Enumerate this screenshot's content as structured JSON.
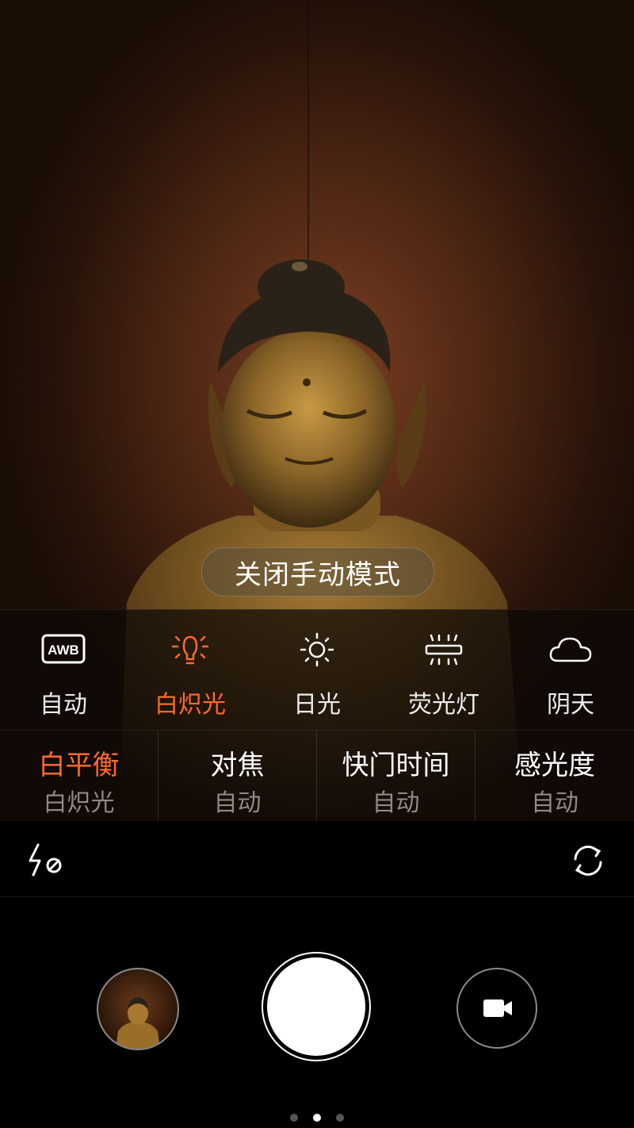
{
  "manual_mode": {
    "close_label": "关闭手动模式"
  },
  "white_balance": {
    "options": [
      {
        "label": "自动",
        "icon": "awb-icon"
      },
      {
        "label": "白炽光",
        "icon": "bulb-icon",
        "selected": true
      },
      {
        "label": "日光",
        "icon": "sun-icon"
      },
      {
        "label": "荧光灯",
        "icon": "fluorescent-icon"
      },
      {
        "label": "阴天",
        "icon": "cloud-icon"
      }
    ],
    "awb_text": "AWB"
  },
  "settings_tabs": [
    {
      "title": "白平衡",
      "value": "白炽光",
      "active": true
    },
    {
      "title": "对焦",
      "value": "自动"
    },
    {
      "title": "快门时间",
      "value": "自动"
    },
    {
      "title": "感光度",
      "value": "自动"
    }
  ],
  "colors": {
    "accent": "#ff6a2b",
    "text": "#ffffff",
    "muted": "#8f8a86"
  },
  "page_indicator": {
    "count": 3,
    "current": 2
  }
}
